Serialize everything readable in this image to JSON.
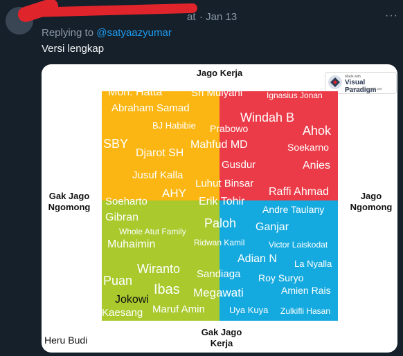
{
  "tweet": {
    "date": "· Jan 13",
    "handle_tail": "at",
    "more": "···",
    "replying_to_prefix": "Replying to ",
    "replying_to_handle": "@satyaazyumar",
    "text": "Versi lengkap"
  },
  "image": {
    "axis_top": "Jago Kerja",
    "axis_bottom_line1": "Gak Jago",
    "axis_bottom_line2": "Kerja",
    "axis_left_line1": "Gak Jago",
    "axis_left_line2": "Ngomong",
    "axis_right_line1": "Jago",
    "axis_right_line2": "Ngomong",
    "author": "Heru Budi",
    "logo": {
      "made": "Made with",
      "brand": "Visual Paradigm",
      "sub": "For non-commercial use"
    },
    "colors": {
      "yellow": "#fbb613",
      "red": "#ec3b48",
      "green": "#a9c92d",
      "blue": "#15aadf"
    },
    "quadrants": {
      "yellow": [
        "Moh. Hatta",
        "Abraham Samad",
        "BJ Habibie",
        "SBY",
        "Djarot SH",
        "Jusuf Kalla",
        "AHY"
      ],
      "red": [
        "Ignasius Jonan",
        "Windah B",
        "Ahok",
        "Soekarno",
        "Anies",
        "Raffi Ahmad"
      ],
      "center": [
        "Sri Mulyani",
        "Prabowo",
        "Mahfud MD",
        "Gusdur",
        "Luhut Binsar",
        "Erik Tohir",
        "Paloh",
        "Ridwan Kamil",
        "Adian N",
        "Sandiaga",
        "Roy Suryo",
        "Megawati",
        "Uya Kuya"
      ],
      "green": [
        "Soeharto",
        "Gibran",
        "Whole Atut Family",
        "Muhaimin",
        "Wiranto",
        "Puan",
        "Ibas",
        "Jokowi",
        "Kaesang",
        "Maruf Amin"
      ],
      "blue": [
        "Andre Taulany",
        "Ganjar",
        "Victor Laiskodat",
        "La Nyalla",
        "Amien Rais",
        "Zulkifli Hasan"
      ]
    }
  }
}
